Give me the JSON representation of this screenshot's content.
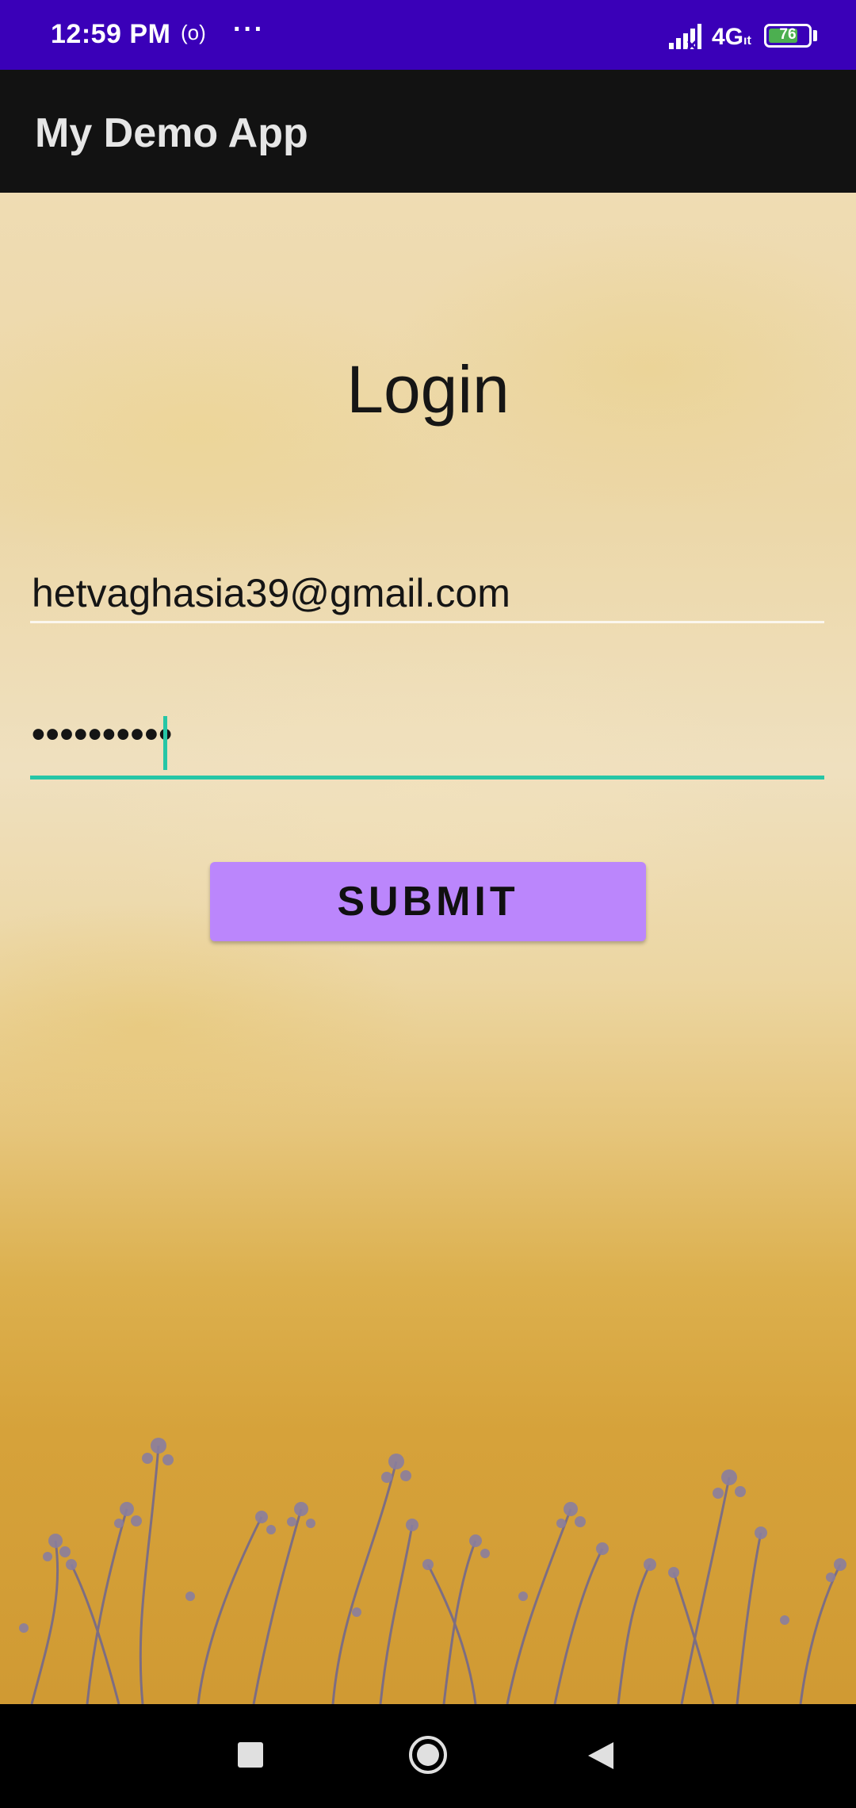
{
  "status_bar": {
    "time": "12:59 PM",
    "hotspot_symbol": "(o)",
    "more_symbol": "···",
    "network": "4G",
    "network_suffix": "ıt",
    "battery_level": "76",
    "battery_percent": 76,
    "icons": [
      "hotspot-icon",
      "more-dots-icon",
      "signal-icon",
      "battery-icon"
    ]
  },
  "app_bar": {
    "title": "My Demo App"
  },
  "login": {
    "title": "Login",
    "email_value": "hetvaghasia39@gmail.com",
    "password_value": "••••••••••",
    "submit_label": "SUBMIT"
  },
  "nav_bar": {
    "icons": [
      "recent-apps-icon",
      "home-icon",
      "back-icon"
    ]
  },
  "colors": {
    "status_bar": "#3a00b8",
    "app_bar": "#121212",
    "accent": "#26c6a6",
    "button": "#bb86fc"
  }
}
